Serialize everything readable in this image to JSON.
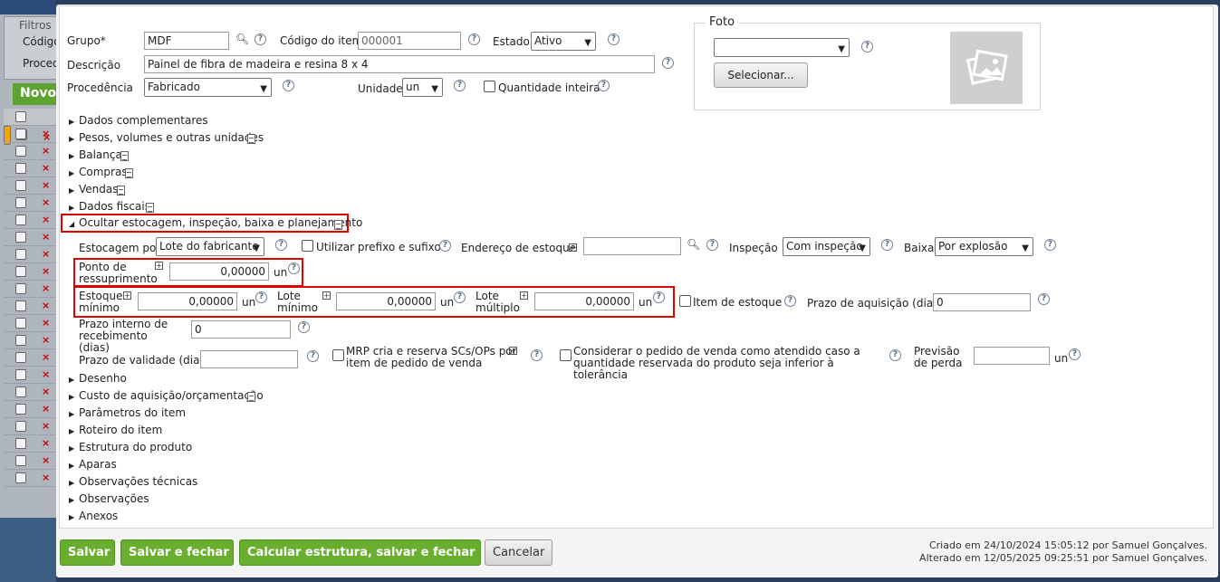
{
  "background": {
    "filter_title": "Filtros",
    "filter_codigo": "Código",
    "filter_proced": "Proced",
    "novo_label": "Novo"
  },
  "form": {
    "grupo_label": "Grupo*",
    "grupo_value": "MDF",
    "codigo_label": "Código do item",
    "codigo_value": "000001",
    "estado_label": "Estado",
    "estado_value": "Ativo",
    "descricao_label": "Descrição",
    "descricao_value": "Painel de fibra de madeira e resina 8 x 4",
    "procedencia_label": "Procedência",
    "procedencia_value": "Fabricado",
    "unidade_label": "Unidade",
    "unidade_value": "un",
    "quantidade_inteira_label": "Quantidade inteira"
  },
  "foto": {
    "legend": "Foto",
    "selecionar_label": "Selecionar..."
  },
  "sections": [
    {
      "label": "Dados complementares"
    },
    {
      "label": "Pesos, volumes e outras unidades"
    },
    {
      "label": "Balança"
    },
    {
      "label": "Compras"
    },
    {
      "label": "Vendas"
    },
    {
      "label": "Dados fiscais"
    },
    {
      "label": "Ocultar estocagem, inspeção, baixa e planejamento"
    }
  ],
  "estocagem": {
    "estocagem_por_label": "Estocagem por",
    "estocagem_por_value": "Lote do fabricante",
    "prefixo_label": "Utilizar prefixo e sufixo",
    "endereco_label": "Endereço de estoque",
    "inspecao_label": "Inspeção",
    "inspecao_value": "Com inspeção",
    "baixa_label": "Baixa",
    "baixa_value": "Por explosão",
    "ponto_label": "Ponto de ressuprimento",
    "ponto_value": "0,00000",
    "unit": "un",
    "estoque_min_label": "Estoque mínimo",
    "estoque_min_value": "0,00000",
    "lote_min_label": "Lote mínimo",
    "lote_min_value": "0,00000",
    "lote_mult_label": "Lote múltiplo",
    "lote_mult_value": "0,00000",
    "item_estoque_label": "Item de estoque",
    "prazo_aquisicao_label": "Prazo de aquisição (dias)",
    "prazo_aquisicao_value": "0",
    "prazo_interno_label": "Prazo interno de recebimento (dias)",
    "prazo_interno_value": "0",
    "prazo_validade_label": "Prazo de validade (dias)",
    "mrp_label": "MRP cria e reserva SCs/OPs por item de pedido de venda",
    "considerar_label": "Considerar o pedido de venda como atendido caso a quantidade reservada do produto seja inferior à tolerância",
    "previsao_label": "Previsão de perda"
  },
  "sections_after": [
    {
      "label": "Desenho"
    },
    {
      "label": "Custo de aquisição/orçamentação"
    },
    {
      "label": "Parâmetros do item"
    },
    {
      "label": "Roteiro do item"
    },
    {
      "label": "Estrutura do produto"
    },
    {
      "label": "Aparas"
    },
    {
      "label": "Observações técnicas"
    },
    {
      "label": "Observações"
    },
    {
      "label": "Anexos"
    }
  ],
  "footer": {
    "salvar": "Salvar",
    "salvar_fechar": "Salvar e fechar",
    "calcular": "Calcular estrutura, salvar e fechar",
    "cancelar": "Cancelar",
    "criado": "Criado em 24/10/2024 15:05:12 por Samuel Gonçalves.",
    "alterado": "Alterado em 12/05/2025 09:25:51 por Samuel Gonçalves."
  }
}
